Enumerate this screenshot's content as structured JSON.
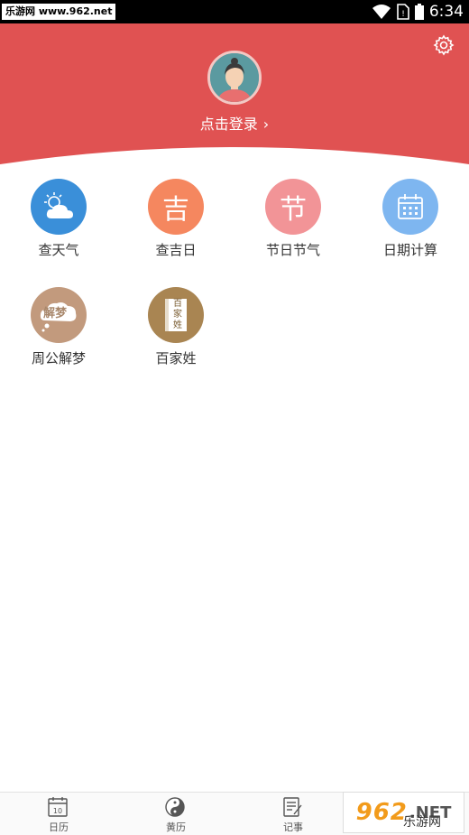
{
  "status_bar": {
    "watermark": "乐游网 www.962.net",
    "time": "6:34"
  },
  "header": {
    "login_text": "点击登录",
    "bg_color": "#e05252"
  },
  "tools": [
    {
      "label": "查天气",
      "color": "#3a8fd9",
      "icon": "weather-icon"
    },
    {
      "label": "查吉日",
      "color": "#f5875f",
      "icon": "ji-icon",
      "glyph": "吉"
    },
    {
      "label": "节日节气",
      "color": "#f29497",
      "icon": "jie-icon",
      "glyph": "节"
    },
    {
      "label": "日期计算",
      "color": "#7eb6f0",
      "icon": "calendar-icon"
    },
    {
      "label": "周公解梦",
      "color": "#c29a7d",
      "icon": "dream-icon",
      "glyph": "解梦"
    },
    {
      "label": "百家姓",
      "color": "#a98552",
      "icon": "surname-book-icon",
      "glyph": "百家姓"
    }
  ],
  "bottom_nav": [
    {
      "label": "日历",
      "icon": "calendar-day-icon",
      "day": "10"
    },
    {
      "label": "黄历",
      "icon": "yin-yang-icon"
    },
    {
      "label": "记事",
      "icon": "notes-icon"
    }
  ],
  "watermark_bottom": {
    "big": "962",
    "net": ".NET",
    "cn": "乐游网"
  }
}
